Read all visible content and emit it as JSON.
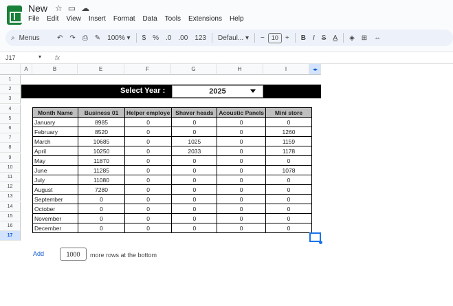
{
  "app": {
    "doc_title": "New",
    "menu": [
      "File",
      "Edit",
      "View",
      "Insert",
      "Format",
      "Data",
      "Tools",
      "Extensions",
      "Help"
    ]
  },
  "toolbar": {
    "search_label": "Menus",
    "zoom": "100%",
    "currency": "$",
    "percent": "%",
    "dec_decrease": ".0",
    "dec_increase": ".00",
    "number_format": "123",
    "font": "Defaul...",
    "font_size": "10",
    "bold": "B",
    "italic": "I",
    "strike": "S",
    "text_color": "A"
  },
  "formula_bar": {
    "name_box": "J17",
    "fx": "fx"
  },
  "columns": [
    "A",
    "B",
    "E",
    "F",
    "G",
    "H",
    "I"
  ],
  "rows": [
    "1",
    "2",
    "3",
    "4",
    "5",
    "6",
    "7",
    "8",
    "9",
    "10",
    "11",
    "12",
    "13",
    "14",
    "15",
    "16",
    "17"
  ],
  "selected_row": "17",
  "sheet": {
    "select_label": "Select Year :",
    "year": "2025",
    "headers": [
      "Month Name",
      "Business 01",
      "Helper employe",
      "Shaver heads",
      "Acoustic Panels",
      "Mini store"
    ],
    "rows": [
      [
        "January",
        "8985",
        "0",
        "0",
        "0",
        "0"
      ],
      [
        "February",
        "8520",
        "0",
        "0",
        "0",
        "1260"
      ],
      [
        "March",
        "10685",
        "0",
        "1025",
        "0",
        "1159"
      ],
      [
        "April",
        "10250",
        "0",
        "2033",
        "0",
        "1178"
      ],
      [
        "May",
        "11870",
        "0",
        "0",
        "0",
        "0"
      ],
      [
        "June",
        "11285",
        "0",
        "0",
        "0",
        "1078"
      ],
      [
        "July",
        "11080",
        "0",
        "0",
        "0",
        "0"
      ],
      [
        "August",
        "7280",
        "0",
        "0",
        "0",
        "0"
      ],
      [
        "September",
        "0",
        "0",
        "0",
        "0",
        "0"
      ],
      [
        "October",
        "0",
        "0",
        "0",
        "0",
        "0"
      ],
      [
        "November",
        "0",
        "0",
        "0",
        "0",
        "0"
      ],
      [
        "December",
        "0",
        "0",
        "0",
        "0",
        "0"
      ]
    ]
  },
  "add_rows": {
    "button": "Add",
    "count": "1000",
    "suffix": "more rows at the bottom"
  }
}
